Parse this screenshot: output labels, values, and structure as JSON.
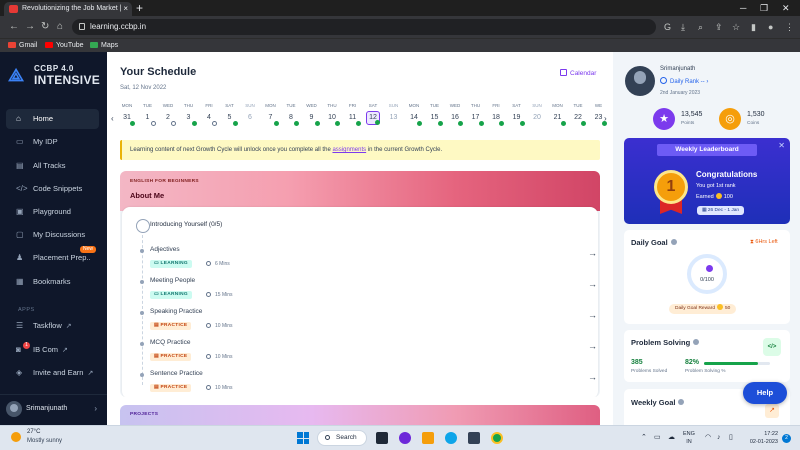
{
  "browser": {
    "tab_title": "Revolutionizing the Job Market | ",
    "tab_close": "×",
    "new_tab": "+",
    "url": "learning.ccbp.in",
    "bookmarks": [
      "Gmail",
      "YouTube",
      "Maps"
    ]
  },
  "sidebar": {
    "logo_line1": "CCBP 4.0",
    "logo_line2": "INTENSIVE",
    "nav": [
      {
        "label": "Home",
        "icon": "home-icon"
      },
      {
        "label": "My IDP",
        "icon": "id-card-icon"
      },
      {
        "label": "All Tracks",
        "icon": "book-icon"
      },
      {
        "label": "Code Snippets",
        "icon": "code-icon"
      },
      {
        "label": "Playground",
        "icon": "terminal-icon"
      },
      {
        "label": "My Discussions",
        "icon": "chat-icon"
      },
      {
        "label": "Placement Prep..",
        "icon": "placement-icon"
      },
      {
        "label": "Bookmarks",
        "icon": "bookmark-icon"
      }
    ],
    "new_badge": "New",
    "apps_label": "APPS",
    "apps": [
      {
        "label": "Taskflow"
      },
      {
        "label": "IB Com"
      },
      {
        "label": "Invite and Earn"
      }
    ],
    "ib_badge": "1",
    "user_name": "Srimanjunath"
  },
  "schedule": {
    "title": "Your Schedule",
    "date": "Sat, 12 Nov 2022",
    "calendar_label": "Calendar",
    "days": [
      {
        "name": "MON",
        "date": "31",
        "status": "done"
      },
      {
        "name": "TUE",
        "date": "1",
        "status": "pending"
      },
      {
        "name": "WED",
        "date": "2",
        "status": "pending"
      },
      {
        "name": "THU",
        "date": "3",
        "status": "done"
      },
      {
        "name": "FRI",
        "date": "4",
        "status": "pending"
      },
      {
        "name": "SAT",
        "date": "5",
        "status": "done"
      },
      {
        "name": "SUN",
        "date": "6",
        "status": "none",
        "dim": true
      },
      {
        "name": "MON",
        "date": "7",
        "status": "done"
      },
      {
        "name": "TUE",
        "date": "8",
        "status": "done"
      },
      {
        "name": "WED",
        "date": "9",
        "status": "done"
      },
      {
        "name": "THU",
        "date": "10",
        "status": "done"
      },
      {
        "name": "FRI",
        "date": "11",
        "status": "done"
      },
      {
        "name": "SAT",
        "date": "12",
        "status": "done",
        "selected": true
      },
      {
        "name": "SUN",
        "date": "13",
        "status": "none",
        "dim": true
      },
      {
        "name": "MON",
        "date": "14",
        "status": "done"
      },
      {
        "name": "TUE",
        "date": "15",
        "status": "done"
      },
      {
        "name": "WED",
        "date": "16",
        "status": "done"
      },
      {
        "name": "THU",
        "date": "17",
        "status": "done"
      },
      {
        "name": "FRI",
        "date": "18",
        "status": "done"
      },
      {
        "name": "SAT",
        "date": "19",
        "status": "done"
      },
      {
        "name": "SUN",
        "date": "20",
        "status": "none",
        "dim": true
      },
      {
        "name": "MON",
        "date": "21",
        "status": "done"
      },
      {
        "name": "TUE",
        "date": "22",
        "status": "done"
      },
      {
        "name": "WE",
        "date": "23",
        "status": "done"
      }
    ],
    "notice_before": "Learning content of next Growth Cycle will unlock once you complete all the ",
    "notice_link": "assignments",
    "notice_after": " in the current Growth Cycle."
  },
  "course": {
    "category": "ENGLISH FOR BEGINNERS",
    "name": "About Me",
    "topic": "Introducing Yourself (0/5)",
    "items": [
      {
        "name": "Adjectives",
        "tag": "LEARNING",
        "duration": "6 Mins"
      },
      {
        "name": "Meeting People",
        "tag": "LEARNING",
        "duration": "15 Mins"
      },
      {
        "name": "Speaking Practice",
        "tag": "PRACTICE",
        "duration": "10 Mins"
      },
      {
        "name": "MCQ Practice",
        "tag": "PRACTICE",
        "duration": "10 Mins"
      },
      {
        "name": "Sentence Practice",
        "tag": "PRACTICE",
        "duration": "10 Mins"
      }
    ],
    "projects_label": "PROJECTS"
  },
  "profile": {
    "name": "Srimanjunath",
    "rank": "Daily Rank --",
    "joined": "2nd January 2023",
    "points_value": "13,545",
    "points_label": "Points",
    "coins_value": "1,530",
    "coins_label": "Coins"
  },
  "leaderboard": {
    "title": "Weekly Leaderboard",
    "medal": "1",
    "congrats": "Congratulations",
    "rank_text": "You got 1st rank",
    "earned_label": "Earned",
    "earned_value": "100",
    "range": "26 Dec - 1 Jan"
  },
  "daily_goal": {
    "title": "Daily Goal",
    "hours_left": "6Hrs Left",
    "progress": "0/100",
    "progress_fraction": 0,
    "reward_label": "Daily Goal Reward",
    "reward_value": "50"
  },
  "problem_solving": {
    "title": "Problem Solving",
    "code_icon": "</>",
    "solved_value": "385",
    "solved_label": "Problems Solved",
    "percent_value": "82%",
    "percent_label": "Problem Solving %",
    "percent_fraction": 0.82
  },
  "weekly_goal": {
    "title": "Weekly Goal"
  },
  "help": "Help",
  "taskbar": {
    "temp": "27°C",
    "weather": "Mostly sunny",
    "search": "Search",
    "lang1": "ENG",
    "lang2": "IN",
    "time": "17:22",
    "date": "02-01-2023",
    "notif_count": "2"
  },
  "colors": {
    "accent": "#7c3aed",
    "sidebar_bg": "#0f172a",
    "leaderboard_bg": "#2a2fc4",
    "success": "#16a34a"
  }
}
